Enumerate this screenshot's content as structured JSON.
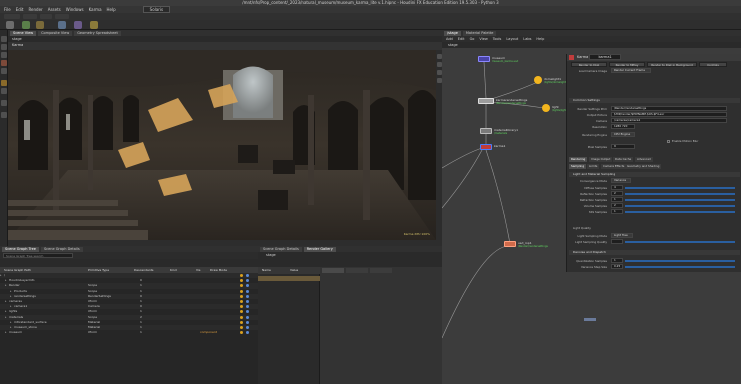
{
  "window": {
    "title": "/mnt/nfs/Prop_content/_2023/natural_museum/museum_karma_lite v.1.hipnc - Houdini FX Education Edition 19.5.303 - Python 3"
  },
  "menubar": [
    "File",
    "Edit",
    "Render",
    "Assets",
    "Windows",
    "Karma",
    "Help"
  ],
  "desktop": "Solaris",
  "viewport": {
    "tabs": [
      "Scene View",
      "Composite View",
      "Geometry Spreadsheet"
    ],
    "path": "stage",
    "title": "Karma",
    "status": "Karma XPU 100%"
  },
  "scene_graph": {
    "tabs": [
      "Scene Graph Tree",
      "Scene Graph Details"
    ],
    "search_placeholder": "Scene Graph Tree search",
    "columns": [
      "Scene Graph Path",
      "Primitive Type",
      "Descendants",
      "Kind",
      "Vis",
      "Draw Mode"
    ],
    "rows": [
      {
        "path": "/",
        "type": "",
        "desc": "",
        "indent": 0
      },
      {
        "path": "HoudiniLayerInfo",
        "type": "",
        "desc": "0",
        "indent": 1
      },
      {
        "path": "Render",
        "type": "Scope",
        "desc": "1",
        "indent": 1
      },
      {
        "path": "Products",
        "type": "Scope",
        "desc": "1",
        "indent": 2
      },
      {
        "path": "rendersettings",
        "type": "RenderSettings",
        "desc": "0",
        "indent": 2
      },
      {
        "path": "cameras",
        "type": "Xform",
        "desc": "1",
        "indent": 1
      },
      {
        "path": "camera1",
        "type": "Camera",
        "desc": "0",
        "indent": 2
      },
      {
        "path": "lights",
        "type": "Xform",
        "desc": "1",
        "indent": 1
      },
      {
        "path": "materials",
        "type": "Scope",
        "desc": "2",
        "indent": 1
      },
      {
        "path": "mtlxstandard_surface",
        "type": "Material",
        "desc": "1",
        "indent": 2
      },
      {
        "path": "museum_stone",
        "type": "Material",
        "desc": "1",
        "indent": 2
      },
      {
        "path": "museum",
        "type": "Xform",
        "desc": "1",
        "indent": 1,
        "kind": "component"
      }
    ]
  },
  "param_panel": {
    "tabs": [
      "Scene Graph Details",
      "Render Gallery"
    ],
    "path": "stage",
    "columns": [
      "Name",
      "Value"
    ]
  },
  "network": {
    "tabs": [
      "/stage",
      "Material Palette"
    ],
    "menu": [
      "Add",
      "Edit",
      "Go",
      "View",
      "Tools",
      "Layout",
      "Labs",
      "Help"
    ],
    "path": "stage",
    "nodes": [
      {
        "name": "museum",
        "sub": "museum_karma.usd"
      },
      {
        "name": "domelight1",
        "sub": "/lights/domelight1"
      },
      {
        "name": "light",
        "sub": "/lights/light1"
      },
      {
        "name": "karmarendersettings",
        "sub": "/Render/rendersettings"
      },
      {
        "name": "materiallibrary1",
        "sub": "/materials"
      },
      {
        "name": "karma1",
        "sub": ""
      },
      {
        "name": "usd_rop1",
        "sub": "/Render/rendersettings"
      }
    ]
  },
  "karma": {
    "node_type": "Karma",
    "node_name": "karma1",
    "buttons": [
      "Render to Disk",
      "Render to MPlay",
      "Render to Disk in Background",
      "Controls"
    ],
    "load_camera_label": "Load Camera Image",
    "load_camera_value": "Render Current Frame",
    "section_render_settings": "Common Settings",
    "fields": [
      {
        "label": "Render Settings Prim",
        "value": "/Render/rendersettings"
      },
      {
        "label": "Output Picture",
        "value": "$HIP/render/$HIPNAME.$OS.$F4.exr"
      },
      {
        "label": "Camera",
        "value": "/cameras/camera1"
      },
      {
        "label": "Resolution",
        "value": "1280   720"
      },
      {
        "label": "Rendering Engine",
        "value": "CPU Engine"
      },
      {
        "label": "Pixel Samples",
        "value": "9"
      }
    ],
    "motion_blur_label": "Enable Motion Blur",
    "tabs": [
      "Rendering",
      "Image Output",
      "Data Cache",
      "Advanced"
    ],
    "subtabs": [
      "Sampling",
      "Limits",
      "Camera Effects",
      "Geometry and Shading"
    ],
    "section_sampling": "Light and Material Sampling",
    "sampling": [
      {
        "label": "Convergence Mode",
        "value": "Variance"
      },
      {
        "label": "Diffuse Samples",
        "value": "4"
      },
      {
        "label": "Reflection Samples",
        "value": "2"
      },
      {
        "label": "Refraction Samples",
        "value": "1"
      },
      {
        "label": "Volume Samples",
        "value": "2"
      },
      {
        "label": "SSS Samples",
        "value": "1"
      }
    ],
    "light_quality_label": "Light Quality",
    "light_sampling_mode_label": "Light Sampling Mode",
    "light_sampling_mode_value": "Light Tree",
    "light_sampling_quality_label": "Light Sampling Quality",
    "section_denoise": "Denoise and Dispatch",
    "denoise": [
      {
        "label": "Quantization Samples",
        "value": "1"
      },
      {
        "label": "Variance Step Size",
        "value": "0.25"
      }
    ]
  }
}
